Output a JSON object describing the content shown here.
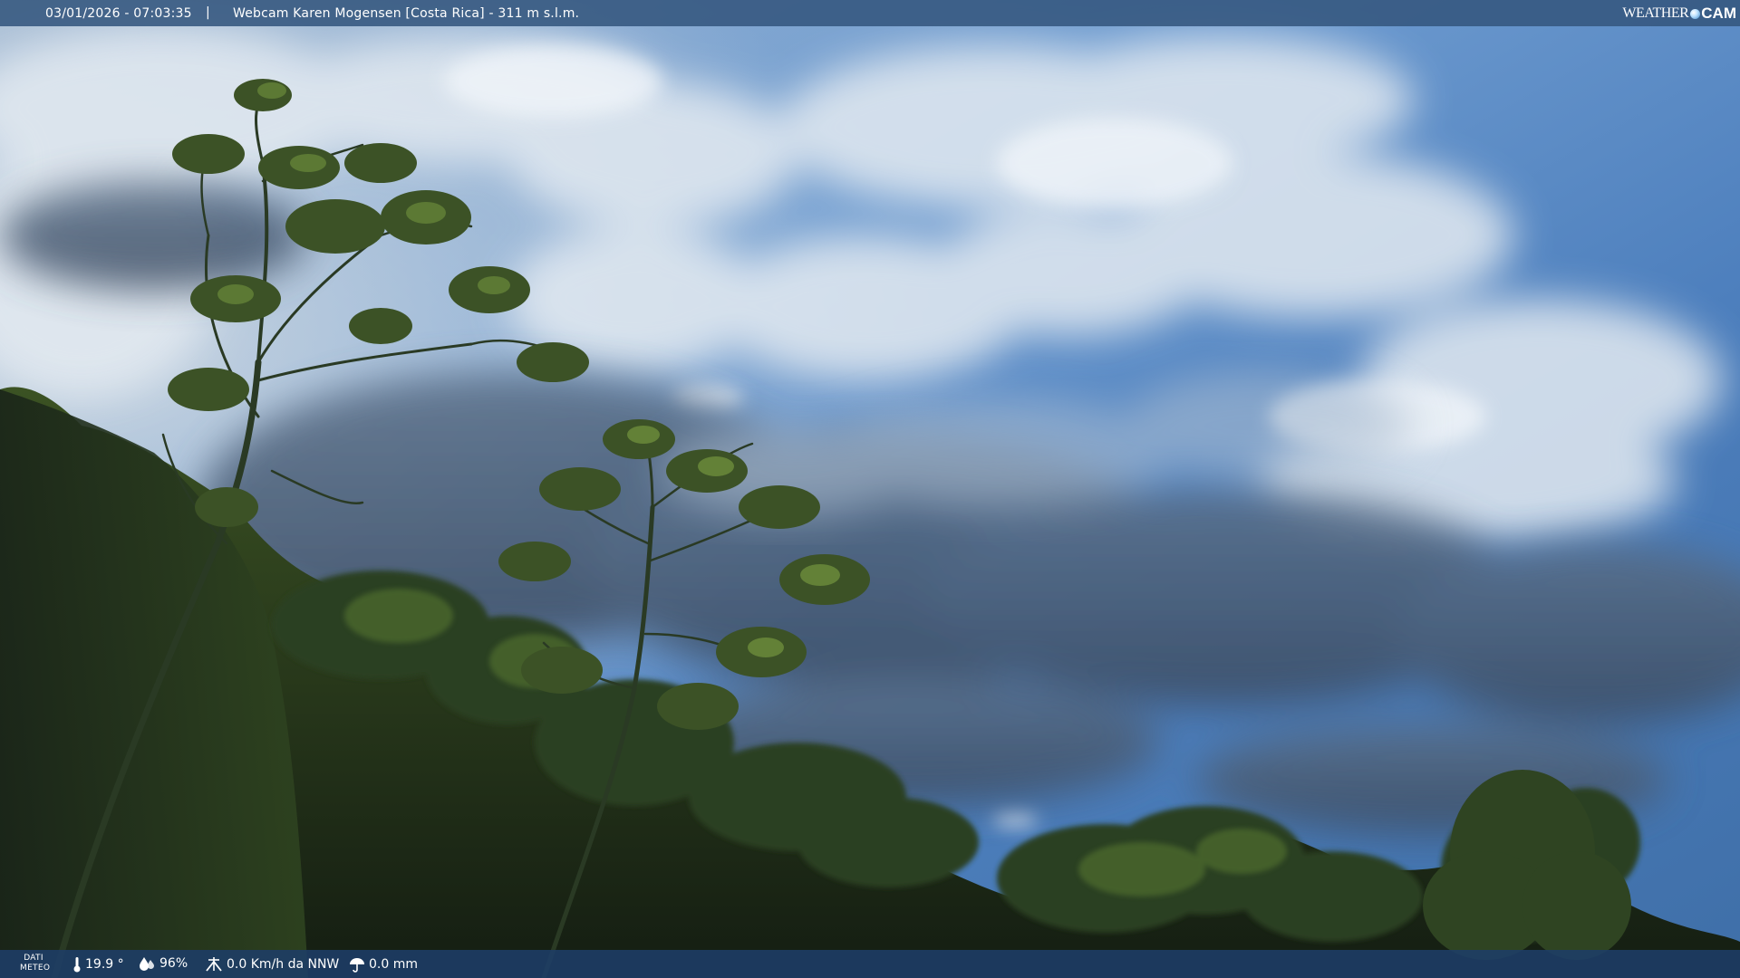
{
  "header": {
    "timestamp": "03/01/2026 - 07:03:35",
    "separator": "|",
    "camera_title": "Webcam Karen Mogensen [Costa Rica] - 311 m s.l.m.",
    "logo_weather": "WEATHER",
    "logo_cam": "CAM"
  },
  "footer": {
    "dati_line1": "DATI",
    "dati_line2": "METEO",
    "temperature": "19.9 °",
    "humidity": "96%",
    "wind": "0.0 Km/h da NNW",
    "rain": "0.0 mm"
  },
  "icons": {
    "temperature": "thermometer-icon",
    "humidity": "droplet-icon",
    "wind": "wind-icon",
    "rain": "umbrella-icon",
    "logo_dot": "globe-icon"
  },
  "colors": {
    "top_bar": "#34567e",
    "bottom_bar": "#1e3e68",
    "sky_top": "#4a7fbf",
    "sky_mid": "#6c95c8",
    "cloud": "#e4ecf3",
    "foliage_dark": "#1d2a18",
    "foliage_light": "#4f6b2c"
  }
}
